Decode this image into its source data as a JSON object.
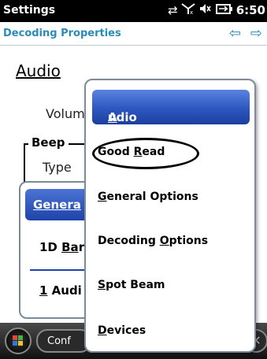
{
  "status_bar": {
    "title": "Settings",
    "time": "6:50",
    "icons": [
      "sync-icon",
      "no-signal-icon",
      "speaker-mute-icon",
      "battery-charging-icon"
    ]
  },
  "header": {
    "title": "Decoding Properties",
    "left_arrow_icon": "arrow-left-icon",
    "right_arrow_icon": "arrow-right-icon"
  },
  "page": {
    "section_title": "Audio",
    "volume_label": "Volum",
    "beep_legend": "Beep",
    "type_label": "Type"
  },
  "background_menu": {
    "selected": "Genera",
    "item1_prefix": "1D ",
    "item1_accel": "Ba",
    "item1_suffix": "r",
    "item2_prefix": "1",
    "item2_suffix": " Audi"
  },
  "taskbar": {
    "start_icon": "windows-start-icon",
    "left_button": "Conf",
    "close_icon": "close-icon"
  },
  "popup_menu": {
    "items": [
      {
        "accel": "A",
        "rest": "udio",
        "selected": true
      },
      {
        "pre": "Good ",
        "accel": "R",
        "rest": "ead",
        "highlighted": true
      },
      {
        "accel": "G",
        "rest": "eneral Options"
      },
      {
        "pre": "Decoding ",
        "accel": "O",
        "rest": "ptions"
      },
      {
        "accel": "S",
        "rest": "pot Beam"
      },
      {
        "accel": "D",
        "rest": "evices"
      }
    ]
  }
}
